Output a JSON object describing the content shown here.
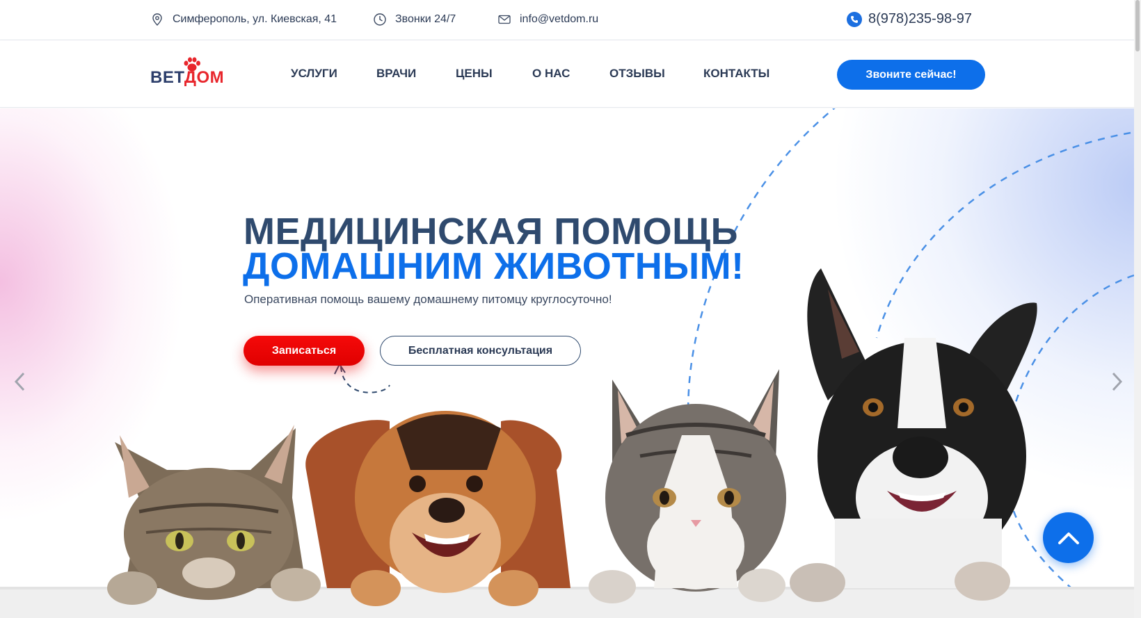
{
  "topbar": {
    "address": "Симферополь, ул. Киевская, 41",
    "hours": "Звонки 24/7",
    "email": "info@vetdom.ru",
    "phone": "8(978)235-98-97"
  },
  "logo": {
    "part1": "ВЕТ",
    "part2": "ДОМ"
  },
  "nav": {
    "items": [
      "УСЛУГИ",
      "ВРАЧИ",
      "ЦЕНЫ",
      "О НАС",
      "ОТЗЫВЫ",
      "КОНТАКТЫ"
    ],
    "cta": "Звоните сейчас!"
  },
  "hero": {
    "title_line1": "МЕДИЦИНСКАЯ ПОМОЩЬ",
    "title_line2": "ДОМАШНИМ ЖИВОТНЫМ!",
    "subtitle": "Оперативная помощь вашему домашнему питомцу круглосуточно!",
    "primary_button": "Записаться",
    "secondary_button": "Бесплатная консультация"
  },
  "icons": {
    "address": "location-pin-icon",
    "hours": "clock-icon",
    "email": "envelope-icon",
    "phone": "phone-icon",
    "prev": "chevron-left-icon",
    "next": "chevron-right-icon",
    "scroll_top": "chevron-up-icon"
  },
  "colors": {
    "brand_blue": "#0d6fea",
    "brand_red": "#e8262c",
    "cta_red": "#f20808",
    "text_dark": "#2f4a6e"
  }
}
